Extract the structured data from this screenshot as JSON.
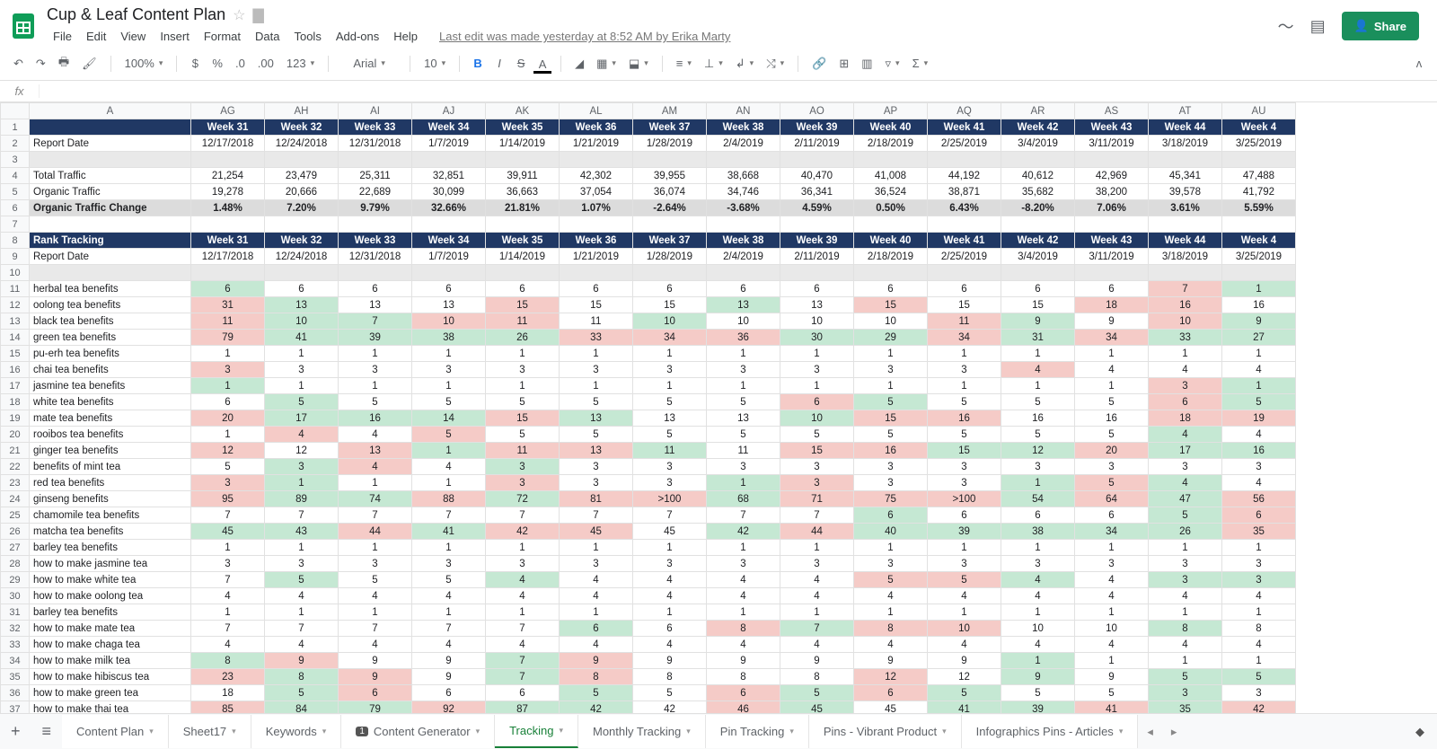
{
  "header": {
    "doc_title": "Cup & Leaf Content Plan",
    "last_edit": "Last edit was made yesterday at 8:52 AM by Erika Marty",
    "share": "Share",
    "menus": [
      "File",
      "Edit",
      "View",
      "Insert",
      "Format",
      "Data",
      "Tools",
      "Add-ons",
      "Help"
    ]
  },
  "toolbar": {
    "zoom": "100%",
    "currency": "$",
    "pct": "%",
    "dec0": ".0",
    "dec00": ".00",
    "more_fmt": "123",
    "font": "Arial",
    "size": "10"
  },
  "columns": [
    "A",
    "AG",
    "AH",
    "AI",
    "AJ",
    "AK",
    "AL",
    "AM",
    "AN",
    "AO",
    "AP",
    "AQ",
    "AR",
    "AS",
    "AT",
    "AU"
  ],
  "week_header_label": "",
  "weeks": [
    "Week 31",
    "Week 32",
    "Week 33",
    "Week 34",
    "Week 35",
    "Week 36",
    "Week 37",
    "Week 38",
    "Week 39",
    "Week 40",
    "Week 41",
    "Week 42",
    "Week 43",
    "Week 44",
    "Week 4"
  ],
  "dates": [
    "12/17/2018",
    "12/24/2018",
    "12/31/2018",
    "1/7/2019",
    "1/14/2019",
    "1/21/2019",
    "1/28/2019",
    "2/4/2019",
    "2/11/2019",
    "2/18/2019",
    "2/25/2019",
    "3/4/2019",
    "3/11/2019",
    "3/18/2019",
    "3/25/2019"
  ],
  "traffic": {
    "report_date_label": "Report Date",
    "total_label": "Total Traffic",
    "organic_label": "Organic Traffic",
    "change_label": "Organic Traffic Change",
    "total": [
      "21,254",
      "23,479",
      "25,311",
      "32,851",
      "39,911",
      "42,302",
      "39,955",
      "38,668",
      "40,470",
      "41,008",
      "44,192",
      "40,612",
      "42,969",
      "45,341",
      "47,488"
    ],
    "organic": [
      "19,278",
      "20,666",
      "22,689",
      "30,099",
      "36,663",
      "37,054",
      "36,074",
      "34,746",
      "36,341",
      "36,524",
      "38,871",
      "35,682",
      "38,200",
      "39,578",
      "41,792"
    ],
    "change": [
      "1.48%",
      "7.20%",
      "9.79%",
      "32.66%",
      "21.81%",
      "1.07%",
      "-2.64%",
      "-3.68%",
      "4.59%",
      "0.50%",
      "6.43%",
      "-8.20%",
      "7.06%",
      "3.61%",
      "5.59%"
    ]
  },
  "rank_section_label": "Rank Tracking",
  "ranks": [
    {
      "kw": "herbal tea benefits",
      "v": [
        "6",
        "6",
        "6",
        "6",
        "6",
        "6",
        "6",
        "6",
        "6",
        "6",
        "6",
        "6",
        "6",
        "7",
        "1"
      ],
      "c": [
        "green",
        "",
        "",
        "",
        "",
        "",
        "",
        "",
        "",
        "",
        "",
        "",
        "",
        "red",
        "green"
      ]
    },
    {
      "kw": "oolong tea benefits",
      "v": [
        "31",
        "13",
        "13",
        "13",
        "15",
        "15",
        "15",
        "13",
        "13",
        "15",
        "15",
        "15",
        "18",
        "16",
        "16"
      ],
      "c": [
        "red",
        "green",
        "",
        "",
        "red",
        "",
        "",
        "green",
        "",
        "red",
        "",
        "",
        "red",
        "red",
        ""
      ]
    },
    {
      "kw": "black tea benefits",
      "v": [
        "11",
        "10",
        "7",
        "10",
        "11",
        "11",
        "10",
        "10",
        "10",
        "10",
        "11",
        "9",
        "9",
        "10",
        "9"
      ],
      "c": [
        "red",
        "green",
        "green",
        "red",
        "red",
        "",
        "green",
        "",
        "",
        "",
        "red",
        "green",
        "",
        "red",
        "green"
      ]
    },
    {
      "kw": "green tea benefits",
      "v": [
        "79",
        "41",
        "39",
        "38",
        "26",
        "33",
        "34",
        "36",
        "30",
        "29",
        "34",
        "31",
        "34",
        "33",
        "27"
      ],
      "c": [
        "red",
        "green",
        "green",
        "green",
        "green",
        "red",
        "red",
        "red",
        "green",
        "green",
        "red",
        "green",
        "red",
        "green",
        "green"
      ]
    },
    {
      "kw": "pu-erh tea benefits",
      "v": [
        "1",
        "1",
        "1",
        "1",
        "1",
        "1",
        "1",
        "1",
        "1",
        "1",
        "1",
        "1",
        "1",
        "1",
        "1"
      ],
      "c": [
        "",
        "",
        "",
        "",
        "",
        "",
        "",
        "",
        "",
        "",
        "",
        "",
        "",
        "",
        ""
      ]
    },
    {
      "kw": "chai tea benefits",
      "v": [
        "3",
        "3",
        "3",
        "3",
        "3",
        "3",
        "3",
        "3",
        "3",
        "3",
        "3",
        "4",
        "4",
        "4",
        "4"
      ],
      "c": [
        "red",
        "",
        "",
        "",
        "",
        "",
        "",
        "",
        "",
        "",
        "",
        "red",
        "",
        "",
        ""
      ]
    },
    {
      "kw": "jasmine tea benefits",
      "v": [
        "1",
        "1",
        "1",
        "1",
        "1",
        "1",
        "1",
        "1",
        "1",
        "1",
        "1",
        "1",
        "1",
        "3",
        "1"
      ],
      "c": [
        "green",
        "",
        "",
        "",
        "",
        "",
        "",
        "",
        "",
        "",
        "",
        "",
        "",
        "red",
        "green"
      ]
    },
    {
      "kw": "white tea benefits",
      "v": [
        "6",
        "5",
        "5",
        "5",
        "5",
        "5",
        "5",
        "5",
        "6",
        "5",
        "5",
        "5",
        "5",
        "6",
        "5"
      ],
      "c": [
        "",
        "green",
        "",
        "",
        "",
        "",
        "",
        "",
        "red",
        "green",
        "",
        "",
        "",
        "red",
        "green"
      ]
    },
    {
      "kw": "mate tea benefits",
      "v": [
        "20",
        "17",
        "16",
        "14",
        "15",
        "13",
        "13",
        "13",
        "10",
        "15",
        "16",
        "16",
        "16",
        "18",
        "19"
      ],
      "c": [
        "red",
        "green",
        "green",
        "green",
        "red",
        "green",
        "",
        "",
        "green",
        "red",
        "red",
        "",
        "",
        "red",
        "red"
      ]
    },
    {
      "kw": "rooibos tea benefits",
      "v": [
        "1",
        "4",
        "4",
        "5",
        "5",
        "5",
        "5",
        "5",
        "5",
        "5",
        "5",
        "5",
        "5",
        "4",
        "4"
      ],
      "c": [
        "",
        "red",
        "",
        "red",
        "",
        "",
        "",
        "",
        "",
        "",
        "",
        "",
        "",
        "green",
        ""
      ]
    },
    {
      "kw": "ginger tea benefits",
      "v": [
        "12",
        "12",
        "13",
        "1",
        "11",
        "13",
        "11",
        "11",
        "15",
        "16",
        "15",
        "12",
        "20",
        "17",
        "16"
      ],
      "c": [
        "red",
        "",
        "red",
        "green",
        "red",
        "red",
        "green",
        "",
        "red",
        "red",
        "green",
        "green",
        "red",
        "green",
        "green"
      ]
    },
    {
      "kw": "benefits of mint tea",
      "v": [
        "5",
        "3",
        "4",
        "4",
        "3",
        "3",
        "3",
        "3",
        "3",
        "3",
        "3",
        "3",
        "3",
        "3",
        "3"
      ],
      "c": [
        "",
        "green",
        "red",
        "",
        "green",
        "",
        "",
        "",
        "",
        "",
        "",
        "",
        "",
        "",
        ""
      ]
    },
    {
      "kw": "red tea benefits",
      "v": [
        "3",
        "1",
        "1",
        "1",
        "3",
        "3",
        "3",
        "1",
        "3",
        "3",
        "3",
        "1",
        "5",
        "4",
        "4"
      ],
      "c": [
        "red",
        "green",
        "",
        "",
        "red",
        "",
        "",
        "green",
        "red",
        "",
        "",
        "green",
        "red",
        "green",
        ""
      ]
    },
    {
      "kw": "ginseng benefits",
      "v": [
        "95",
        "89",
        "74",
        "88",
        "72",
        "81",
        ">100",
        "68",
        "71",
        "75",
        ">100",
        "54",
        "64",
        "47",
        "56"
      ],
      "c": [
        "red",
        "green",
        "green",
        "red",
        "green",
        "red",
        "red",
        "green",
        "red",
        "red",
        "red",
        "green",
        "red",
        "green",
        "red"
      ]
    },
    {
      "kw": "chamomile tea benefits",
      "v": [
        "7",
        "7",
        "7",
        "7",
        "7",
        "7",
        "7",
        "7",
        "7",
        "6",
        "6",
        "6",
        "6",
        "5",
        "6"
      ],
      "c": [
        "",
        "",
        "",
        "",
        "",
        "",
        "",
        "",
        "",
        "green",
        "",
        "",
        "",
        "green",
        "red"
      ]
    },
    {
      "kw": "matcha tea benefits",
      "v": [
        "45",
        "43",
        "44",
        "41",
        "42",
        "45",
        "45",
        "42",
        "44",
        "40",
        "39",
        "38",
        "34",
        "26",
        "35"
      ],
      "c": [
        "green",
        "green",
        "red",
        "green",
        "red",
        "red",
        "",
        "green",
        "red",
        "green",
        "green",
        "green",
        "green",
        "green",
        "red"
      ]
    },
    {
      "kw": "barley tea benefits",
      "v": [
        "1",
        "1",
        "1",
        "1",
        "1",
        "1",
        "1",
        "1",
        "1",
        "1",
        "1",
        "1",
        "1",
        "1",
        "1"
      ],
      "c": [
        "",
        "",
        "",
        "",
        "",
        "",
        "",
        "",
        "",
        "",
        "",
        "",
        "",
        "",
        ""
      ]
    },
    {
      "kw": "how to make jasmine tea",
      "v": [
        "3",
        "3",
        "3",
        "3",
        "3",
        "3",
        "3",
        "3",
        "3",
        "3",
        "3",
        "3",
        "3",
        "3",
        "3"
      ],
      "c": [
        "",
        "",
        "",
        "",
        "",
        "",
        "",
        "",
        "",
        "",
        "",
        "",
        "",
        "",
        ""
      ]
    },
    {
      "kw": "how to make white tea",
      "v": [
        "7",
        "5",
        "5",
        "5",
        "4",
        "4",
        "4",
        "4",
        "4",
        "5",
        "5",
        "4",
        "4",
        "3",
        "3"
      ],
      "c": [
        "",
        "green",
        "",
        "",
        "green",
        "",
        "",
        "",
        "",
        "red",
        "red",
        "green",
        "",
        "green",
        "green"
      ]
    },
    {
      "kw": "how to make oolong tea",
      "v": [
        "4",
        "4",
        "4",
        "4",
        "4",
        "4",
        "4",
        "4",
        "4",
        "4",
        "4",
        "4",
        "4",
        "4",
        "4"
      ],
      "c": [
        "",
        "",
        "",
        "",
        "",
        "",
        "",
        "",
        "",
        "",
        "",
        "",
        "",
        "",
        ""
      ]
    },
    {
      "kw": "barley tea benefits",
      "v": [
        "1",
        "1",
        "1",
        "1",
        "1",
        "1",
        "1",
        "1",
        "1",
        "1",
        "1",
        "1",
        "1",
        "1",
        "1"
      ],
      "c": [
        "",
        "",
        "",
        "",
        "",
        "",
        "",
        "",
        "",
        "",
        "",
        "",
        "",
        "",
        ""
      ]
    },
    {
      "kw": "how to make mate tea",
      "v": [
        "7",
        "7",
        "7",
        "7",
        "7",
        "6",
        "6",
        "8",
        "7",
        "8",
        "10",
        "10",
        "10",
        "8",
        "8"
      ],
      "c": [
        "",
        "",
        "",
        "",
        "",
        "green",
        "",
        "red",
        "green",
        "red",
        "red",
        "",
        "",
        "green",
        ""
      ]
    },
    {
      "kw": "how to make chaga tea",
      "v": [
        "4",
        "4",
        "4",
        "4",
        "4",
        "4",
        "4",
        "4",
        "4",
        "4",
        "4",
        "4",
        "4",
        "4",
        "4"
      ],
      "c": [
        "",
        "",
        "",
        "",
        "",
        "",
        "",
        "",
        "",
        "",
        "",
        "",
        "",
        "",
        ""
      ]
    },
    {
      "kw": "how to make milk tea",
      "v": [
        "8",
        "9",
        "9",
        "9",
        "7",
        "9",
        "9",
        "9",
        "9",
        "9",
        "9",
        "1",
        "1",
        "1",
        "1"
      ],
      "c": [
        "green",
        "red",
        "",
        "",
        "green",
        "red",
        "",
        "",
        "",
        "",
        "",
        "green",
        "",
        "",
        ""
      ]
    },
    {
      "kw": "how to make hibiscus tea",
      "v": [
        "23",
        "8",
        "9",
        "9",
        "7",
        "8",
        "8",
        "8",
        "8",
        "12",
        "12",
        "9",
        "9",
        "5",
        "5"
      ],
      "c": [
        "red",
        "green",
        "red",
        "",
        "green",
        "red",
        "",
        "",
        "",
        "red",
        "",
        "green",
        "",
        "green",
        "green"
      ]
    },
    {
      "kw": "how to make green tea",
      "v": [
        "18",
        "5",
        "6",
        "6",
        "6",
        "5",
        "5",
        "6",
        "5",
        "6",
        "5",
        "5",
        "5",
        "3",
        "3"
      ],
      "c": [
        "",
        "green",
        "red",
        "",
        "",
        "green",
        "",
        "red",
        "green",
        "red",
        "green",
        "",
        "",
        "green",
        ""
      ]
    },
    {
      "kw": "how to make thai tea",
      "v": [
        "85",
        "84",
        "79",
        "92",
        "87",
        "42",
        "42",
        "46",
        "45",
        "45",
        "41",
        "39",
        "41",
        "35",
        "42"
      ],
      "c": [
        "red",
        "green",
        "green",
        "red",
        "green",
        "green",
        "",
        "red",
        "green",
        "",
        "green",
        "green",
        "red",
        "green",
        "red"
      ]
    }
  ],
  "sheet_tabs": [
    {
      "label": "Content Plan"
    },
    {
      "label": "Sheet17"
    },
    {
      "label": "Keywords"
    },
    {
      "label": "Content Generator",
      "badge": "1"
    },
    {
      "label": "Tracking",
      "active": true
    },
    {
      "label": "Monthly Tracking"
    },
    {
      "label": "Pin Tracking"
    },
    {
      "label": "Pins - Vibrant Product"
    },
    {
      "label": "Infographics Pins - Articles"
    }
  ]
}
